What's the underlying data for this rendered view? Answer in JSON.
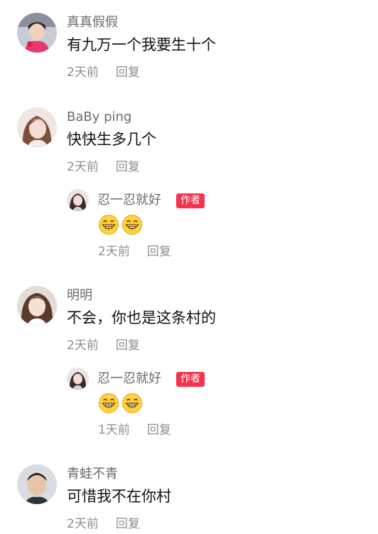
{
  "comments": [
    {
      "username": "真真假假",
      "content": "有九万一个我要生十个",
      "time": "2天前",
      "reply_label": "回复"
    },
    {
      "username": "BaBy ping",
      "content": "快快生多几个",
      "time": "2天前",
      "reply_label": "回复",
      "replies": [
        {
          "username": "忍一忍就好",
          "badge": "作者",
          "emojis": [
            "grin-emoji",
            "grin-emoji"
          ],
          "time": "2天前",
          "reply_label": "回复"
        }
      ]
    },
    {
      "username": "明明",
      "content": "不会，你也是这条村的",
      "time": "2天前",
      "reply_label": "回复",
      "replies": [
        {
          "username": "忍一忍就好",
          "badge": "作者",
          "emojis": [
            "grin-emoji",
            "grin-emoji"
          ],
          "time": "1天前",
          "reply_label": "回复"
        }
      ]
    },
    {
      "username": "青蛙不青",
      "content": "可惜我不在你村",
      "time": "2天前",
      "reply_label": "回复"
    }
  ],
  "colors": {
    "badge": "#f2354d",
    "username": "#6b6b6b",
    "meta": "#8e8e8e",
    "content": "#111111"
  }
}
